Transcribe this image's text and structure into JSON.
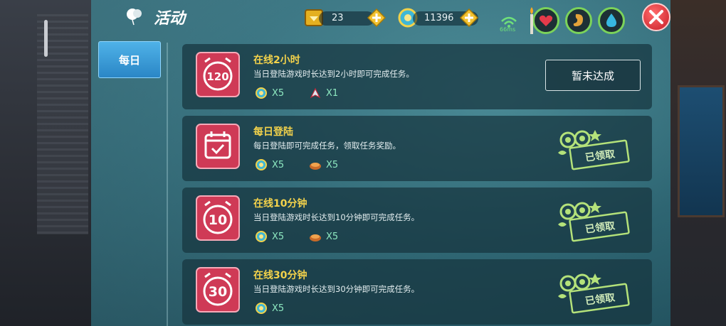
{
  "header": {
    "title": "活动",
    "gems": "23",
    "coins": "11396",
    "ping": "66ms"
  },
  "sidebar": {
    "tabs": [
      {
        "label": "每日"
      }
    ]
  },
  "tasks": [
    {
      "badge": "120",
      "badge_type": "clock",
      "title": "在线2小时",
      "desc": "当日登陆游戏时长达到2小时即可完成任务。",
      "rewards": [
        {
          "icon": "coin-icon",
          "qty": "X5"
        },
        {
          "icon": "rocket-icon",
          "qty": "X1"
        }
      ],
      "status": "暂未达成"
    },
    {
      "badge": "",
      "badge_type": "calendar",
      "title": "每日登陆",
      "desc": "每日登陆即可完成任务，领取任务奖励。",
      "rewards": [
        {
          "icon": "coin-icon",
          "qty": "X5"
        },
        {
          "icon": "food-icon",
          "qty": "X5"
        }
      ],
      "status": "已领取"
    },
    {
      "badge": "10",
      "badge_type": "clock",
      "title": "在线10分钟",
      "desc": "当日登陆游戏时长达到10分钟即可完成任务。",
      "rewards": [
        {
          "icon": "coin-icon",
          "qty": "X5"
        },
        {
          "icon": "food-icon",
          "qty": "X5"
        }
      ],
      "status": "已领取"
    },
    {
      "badge": "30",
      "badge_type": "clock",
      "title": "在线30分钟",
      "desc": "当日登陆游戏时长达到30分钟即可完成任务。",
      "rewards": [
        {
          "icon": "coin-icon",
          "qty": "X5"
        }
      ],
      "status": "已领取"
    }
  ],
  "colors": {
    "accent_title": "#f3d24b",
    "reward_text": "#8de8c0",
    "badge": "#d6405a"
  }
}
